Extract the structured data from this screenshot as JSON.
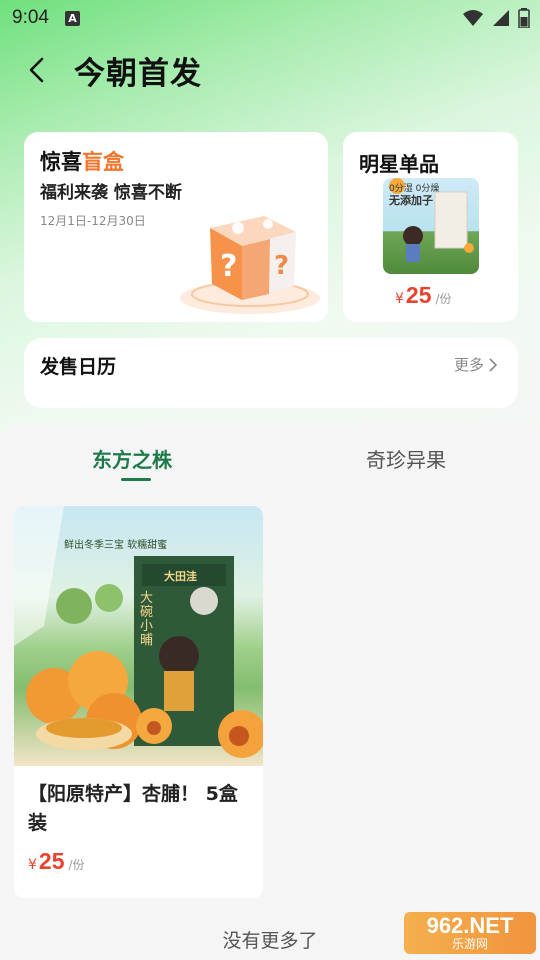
{
  "status_bar": {
    "time": "9:04",
    "notification_icon_letter": "A",
    "icons": [
      "wifi-icon",
      "signal-icon",
      "battery-icon"
    ]
  },
  "header": {
    "title": "今朝首发",
    "back_icon": "chevron-left-icon"
  },
  "blind_box_card": {
    "title_prefix": "惊喜",
    "title_highlight": "盲盒",
    "subtitle": "福利来袭 惊喜不断",
    "date_range": "12月1日-12月30日",
    "image_icon": "gift-box-question-icon"
  },
  "star_product_card": {
    "title": "明星单品",
    "image_text_1": "0分湿 0分燥",
    "image_text_2": "无添加子",
    "price_symbol": "¥",
    "price": "25",
    "unit": "/份"
  },
  "calendar_card": {
    "title": "发售日历",
    "more_label": "更多",
    "more_icon": "chevron-right-icon"
  },
  "tabs": [
    {
      "label": "东方之株",
      "active": true
    },
    {
      "label": "奇珍异果",
      "active": false
    }
  ],
  "products": [
    {
      "banner_text": "鲜出冬季三宝 软糯甜蜜",
      "brand": "大田洼",
      "package_text": "大碗小晡",
      "name": "【阳原特产】杏脯！ 5盒装",
      "price_symbol": "¥",
      "price": "25",
      "unit": "/份"
    }
  ],
  "footer": {
    "no_more_text": "没有更多了"
  },
  "watermark": {
    "line1": "962.NET",
    "line2": "乐游网"
  },
  "colors": {
    "accent_green": "#1e7a4c",
    "highlight_orange": "#f2762c",
    "price_red": "#e8432d"
  }
}
